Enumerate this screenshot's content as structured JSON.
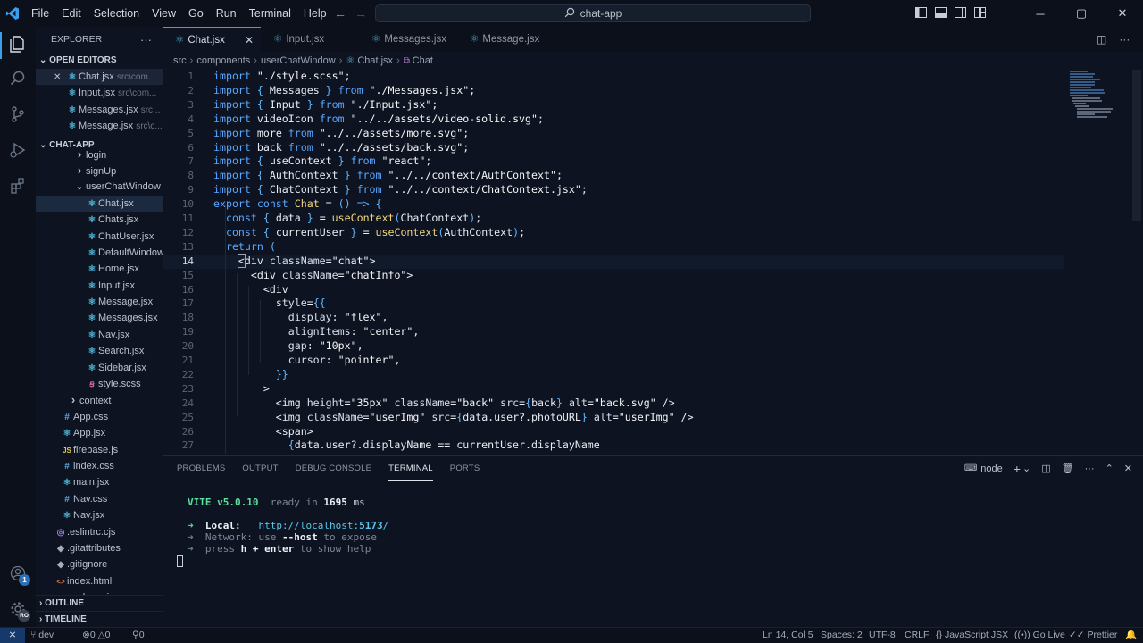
{
  "menu": [
    "File",
    "Edit",
    "Selection",
    "View",
    "Go",
    "Run",
    "Terminal",
    "Help"
  ],
  "search": {
    "text": "chat-app"
  },
  "activity": {
    "badge": "1",
    "avatar": "RO"
  },
  "explorer": {
    "title": "EXPLORER",
    "more": "···",
    "open_editors_label": "OPEN EDITORS",
    "open_editors": [
      {
        "name": "Chat.jsx",
        "path": "src\\com..."
      },
      {
        "name": "Input.jsx",
        "path": "src\\com..."
      },
      {
        "name": "Messages.jsx",
        "path": "src..."
      },
      {
        "name": "Message.jsx",
        "path": "src\\c..."
      }
    ],
    "project_label": "CHAT-APP",
    "tree": [
      {
        "name": "login",
        "kind": "folder",
        "indent": 1
      },
      {
        "name": "signUp",
        "kind": "folder",
        "indent": 1
      },
      {
        "name": "userChatWindow",
        "kind": "folder-open",
        "indent": 1
      },
      {
        "name": "Chat.jsx",
        "kind": "react",
        "indent": 2,
        "selected": true
      },
      {
        "name": "Chats.jsx",
        "kind": "react",
        "indent": 2
      },
      {
        "name": "ChatUser.jsx",
        "kind": "react",
        "indent": 2
      },
      {
        "name": "DefaultWindow.jsx",
        "kind": "react",
        "indent": 2
      },
      {
        "name": "Home.jsx",
        "kind": "react",
        "indent": 2
      },
      {
        "name": "Input.jsx",
        "kind": "react",
        "indent": 2
      },
      {
        "name": "Message.jsx",
        "kind": "react",
        "indent": 2
      },
      {
        "name": "Messages.jsx",
        "kind": "react",
        "indent": 2
      },
      {
        "name": "Nav.jsx",
        "kind": "react",
        "indent": 2
      },
      {
        "name": "Search.jsx",
        "kind": "react",
        "indent": 2
      },
      {
        "name": "Sidebar.jsx",
        "kind": "react",
        "indent": 2
      },
      {
        "name": "style.scss",
        "kind": "scss",
        "indent": 2
      },
      {
        "name": "context",
        "kind": "folder",
        "indent": 0.5
      },
      {
        "name": "App.css",
        "kind": "css",
        "indent": 0
      },
      {
        "name": "App.jsx",
        "kind": "react",
        "indent": 0
      },
      {
        "name": "firebase.js",
        "kind": "js",
        "indent": 0
      },
      {
        "name": "index.css",
        "kind": "css",
        "indent": 0
      },
      {
        "name": "main.jsx",
        "kind": "react",
        "indent": 0
      },
      {
        "name": "Nav.css",
        "kind": "css",
        "indent": 0
      },
      {
        "name": "Nav.jsx",
        "kind": "react",
        "indent": 0
      },
      {
        "name": ".eslintrc.cjs",
        "kind": "eslint",
        "indent": -0.5
      },
      {
        "name": ".gitattributes",
        "kind": "git",
        "indent": -0.5
      },
      {
        "name": ".gitignore",
        "kind": "git",
        "indent": -0.5
      },
      {
        "name": "index.html",
        "kind": "html",
        "indent": -0.5
      },
      {
        "name": "package.json",
        "kind": "json",
        "indent": -0.5
      }
    ],
    "outline_label": "OUTLINE",
    "timeline_label": "TIMELINE"
  },
  "tabs": [
    {
      "label": "Chat.jsx",
      "active": true
    },
    {
      "label": "Input.jsx",
      "active": false
    },
    {
      "label": "Messages.jsx",
      "active": false
    },
    {
      "label": "Message.jsx",
      "active": false
    }
  ],
  "breadcrumb": [
    "src",
    "components",
    "userChatWindow",
    "Chat.jsx",
    "Chat"
  ],
  "editor": {
    "current_line": 14,
    "lines": [
      [
        [
          "kw",
          "import "
        ],
        [
          "str",
          "\"./style.scss\""
        ],
        [
          "var",
          ";"
        ]
      ],
      [
        [
          "kw",
          "import "
        ],
        [
          "br",
          "{ "
        ],
        [
          "var",
          "Messages"
        ],
        [
          "br",
          " } "
        ],
        [
          "kw",
          "from "
        ],
        [
          "str",
          "\"./Messages.jsx\""
        ],
        [
          "var",
          ";"
        ]
      ],
      [
        [
          "kw",
          "import "
        ],
        [
          "br",
          "{ "
        ],
        [
          "var",
          "Input"
        ],
        [
          "br",
          " } "
        ],
        [
          "kw",
          "from "
        ],
        [
          "str",
          "\"./Input.jsx\""
        ],
        [
          "var",
          ";"
        ]
      ],
      [
        [
          "kw",
          "import "
        ],
        [
          "var",
          "videoIcon "
        ],
        [
          "kw",
          "from "
        ],
        [
          "str",
          "\"../../assets/video-solid.svg\""
        ],
        [
          "var",
          ";"
        ]
      ],
      [
        [
          "kw",
          "import "
        ],
        [
          "var",
          "more "
        ],
        [
          "kw",
          "from "
        ],
        [
          "str",
          "\"../../assets/more.svg\""
        ],
        [
          "var",
          ";"
        ]
      ],
      [
        [
          "kw",
          "import "
        ],
        [
          "var",
          "back "
        ],
        [
          "kw",
          "from "
        ],
        [
          "str",
          "\"../../assets/back.svg\""
        ],
        [
          "var",
          ";"
        ]
      ],
      [
        [
          "kw",
          "import "
        ],
        [
          "br",
          "{ "
        ],
        [
          "var",
          "useContext"
        ],
        [
          "br",
          " } "
        ],
        [
          "kw",
          "from "
        ],
        [
          "str",
          "\"react\""
        ],
        [
          "var",
          ";"
        ]
      ],
      [
        [
          "kw",
          "import "
        ],
        [
          "br",
          "{ "
        ],
        [
          "var",
          "AuthContext"
        ],
        [
          "br",
          " } "
        ],
        [
          "kw",
          "from "
        ],
        [
          "str",
          "\"../../context/AuthContext\""
        ],
        [
          "var",
          ";"
        ]
      ],
      [
        [
          "kw",
          "import "
        ],
        [
          "br",
          "{ "
        ],
        [
          "var",
          "ChatContext"
        ],
        [
          "br",
          " } "
        ],
        [
          "kw",
          "from "
        ],
        [
          "str",
          "\"../../context/ChatContext.jsx\""
        ],
        [
          "var",
          ";"
        ]
      ],
      [
        [
          "kw",
          "export const "
        ],
        [
          "fn",
          "Chat"
        ],
        [
          "var",
          " = "
        ],
        [
          "br",
          "() "
        ],
        [
          "kw",
          "=> "
        ],
        [
          "br",
          "{"
        ]
      ],
      [
        [
          "var",
          "  "
        ],
        [
          "kw",
          "const "
        ],
        [
          "br",
          "{ "
        ],
        [
          "var",
          "data"
        ],
        [
          "br",
          " } "
        ],
        [
          "var",
          "= "
        ],
        [
          "fn",
          "useContext"
        ],
        [
          "br",
          "("
        ],
        [
          "var",
          "ChatContext"
        ],
        [
          "br",
          ")"
        ],
        [
          "var",
          ";"
        ]
      ],
      [
        [
          "var",
          "  "
        ],
        [
          "kw",
          "const "
        ],
        [
          "br",
          "{ "
        ],
        [
          "var",
          "currentUser"
        ],
        [
          "br",
          " } "
        ],
        [
          "var",
          "= "
        ],
        [
          "fn",
          "useContext"
        ],
        [
          "br",
          "("
        ],
        [
          "var",
          "AuthContext"
        ],
        [
          "br",
          ")"
        ],
        [
          "var",
          ";"
        ]
      ],
      [
        [
          "var",
          "  "
        ],
        [
          "kw",
          "return "
        ],
        [
          "br",
          "("
        ]
      ],
      [
        [
          "var",
          "    <"
        ],
        [
          "tag",
          "div "
        ],
        [
          "attr",
          "className"
        ],
        [
          "var",
          "="
        ],
        [
          "str",
          "\"chat\""
        ],
        [
          "var",
          ">"
        ]
      ],
      [
        [
          "var",
          "      <"
        ],
        [
          "tag",
          "div "
        ],
        [
          "attr",
          "className"
        ],
        [
          "var",
          "="
        ],
        [
          "str",
          "\"chatInfo\""
        ],
        [
          "var",
          ">"
        ]
      ],
      [
        [
          "var",
          "        <"
        ],
        [
          "tag",
          "div"
        ]
      ],
      [
        [
          "var",
          "          "
        ],
        [
          "attr",
          "style"
        ],
        [
          "var",
          "="
        ],
        [
          "br",
          "{{"
        ]
      ],
      [
        [
          "var",
          "            "
        ],
        [
          "attr",
          "display"
        ],
        [
          "var",
          ": "
        ],
        [
          "str",
          "\"flex\""
        ],
        [
          "var",
          ","
        ]
      ],
      [
        [
          "var",
          "            "
        ],
        [
          "attr",
          "alignItems"
        ],
        [
          "var",
          ": "
        ],
        [
          "str",
          "\"center\""
        ],
        [
          "var",
          ","
        ]
      ],
      [
        [
          "var",
          "            "
        ],
        [
          "attr",
          "gap"
        ],
        [
          "var",
          ": "
        ],
        [
          "str",
          "\"10px\""
        ],
        [
          "var",
          ","
        ]
      ],
      [
        [
          "var",
          "            "
        ],
        [
          "attr",
          "cursor"
        ],
        [
          "var",
          ": "
        ],
        [
          "str",
          "\"pointer\""
        ],
        [
          "var",
          ","
        ]
      ],
      [
        [
          "var",
          "          "
        ],
        [
          "br",
          "}}"
        ]
      ],
      [
        [
          "var",
          "        >"
        ]
      ],
      [
        [
          "var",
          "          <"
        ],
        [
          "tag",
          "img "
        ],
        [
          "attr",
          "height"
        ],
        [
          "var",
          "="
        ],
        [
          "str",
          "\"35px\" "
        ],
        [
          "attr",
          "className"
        ],
        [
          "var",
          "="
        ],
        [
          "str",
          "\"back\" "
        ],
        [
          "attr",
          "src"
        ],
        [
          "var",
          "="
        ],
        [
          "br",
          "{"
        ],
        [
          "var",
          "back"
        ],
        [
          "br",
          "}"
        ],
        [
          "var",
          " "
        ],
        [
          "attr",
          "alt"
        ],
        [
          "var",
          "="
        ],
        [
          "str",
          "\"back.svg\""
        ],
        [
          "var",
          " />"
        ]
      ],
      [
        [
          "var",
          "          <"
        ],
        [
          "tag",
          "img "
        ],
        [
          "attr",
          "className"
        ],
        [
          "var",
          "="
        ],
        [
          "str",
          "\"userImg\" "
        ],
        [
          "attr",
          "src"
        ],
        [
          "var",
          "="
        ],
        [
          "br",
          "{"
        ],
        [
          "var",
          "data.user?.photoURL"
        ],
        [
          "br",
          "}"
        ],
        [
          "var",
          " "
        ],
        [
          "attr",
          "alt"
        ],
        [
          "var",
          "="
        ],
        [
          "str",
          "\"userImg\""
        ],
        [
          "var",
          " />"
        ]
      ],
      [
        [
          "var",
          "          <"
        ],
        [
          "tag",
          "span"
        ],
        [
          "var",
          ">"
        ]
      ],
      [
        [
          "var",
          "            "
        ],
        [
          "br",
          "{"
        ],
        [
          "var",
          "data.user?.displayName == currentUser.displayName"
        ]
      ],
      [
        [
          "var",
          "              ? currentUser.displayName + \" (You)\""
        ]
      ]
    ]
  },
  "panel": {
    "tabs": [
      "PROBLEMS",
      "OUTPUT",
      "DEBUG CONSOLE",
      "TERMINAL",
      "PORTS"
    ],
    "active_tab": "TERMINAL",
    "shell": "node",
    "terminal": {
      "vite_label": "VITE",
      "vite_version": "v5.0.10",
      "ready_text": "ready in",
      "ready_ms": "1695",
      "ms": "ms",
      "local_label": "Local:",
      "local_url_base": "http://localhost:",
      "local_port": "5173",
      "local_slash": "/",
      "network_label": "Network:",
      "network_use": "use",
      "network_host": "--host",
      "network_expose": "to expose",
      "help_press": "press",
      "help_keys": "h + enter",
      "help_show": "to show help",
      "arrow": "➜"
    }
  },
  "status": {
    "remote_icon": "remote-icon",
    "branch": "dev",
    "errors": "0",
    "warnings": "0",
    "ports": "0",
    "position": "Ln 14, Col 5",
    "spaces": "Spaces: 2",
    "encoding": "UTF-8",
    "eol": "CRLF",
    "language": "JavaScript JSX",
    "golive": "Go Live",
    "prettier": "Prettier"
  },
  "colors": {
    "accent": "#3c9ee8",
    "background": "#0d1321",
    "keyword": "#5aa8ff",
    "function": "#f1d77a",
    "terminal_green": "#5be0a0"
  }
}
